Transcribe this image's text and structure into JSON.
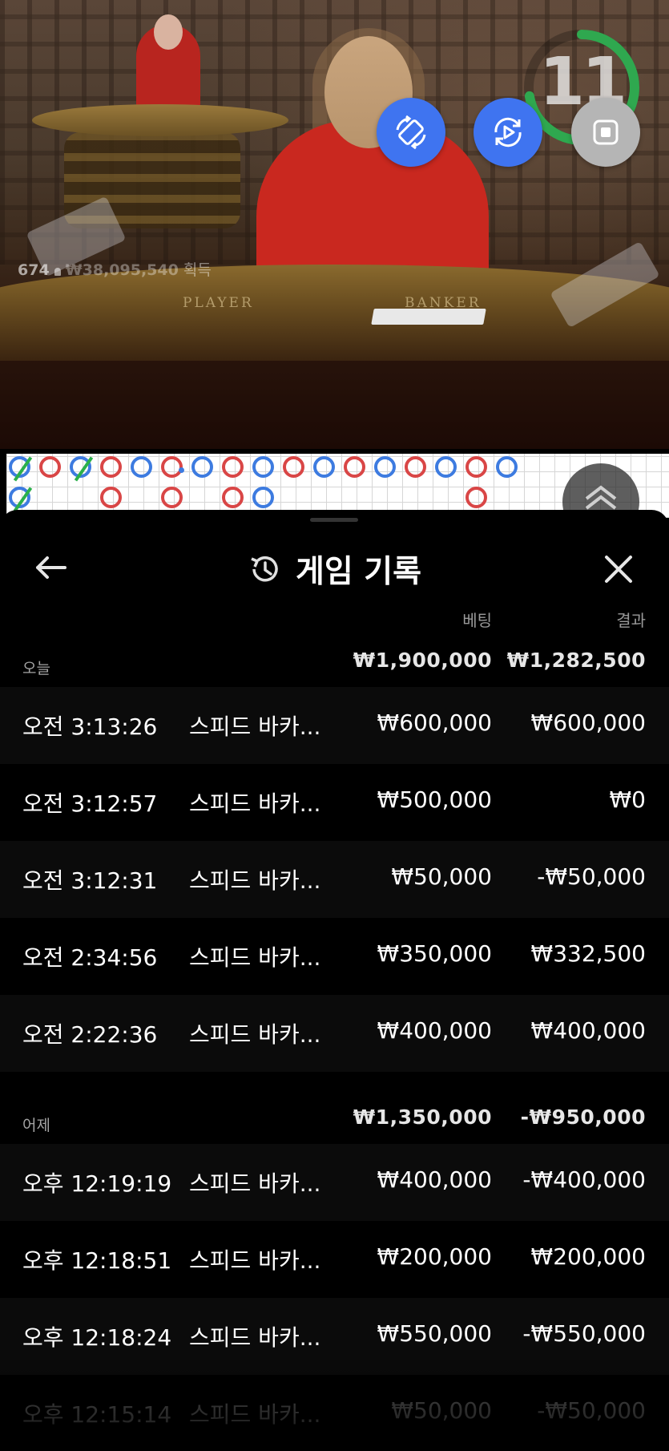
{
  "video": {
    "timer_value": "11",
    "table_labels": [
      "PLAYER",
      "BANKER"
    ],
    "player_count": "674",
    "total_amount": "₩38,095,540",
    "earn_label": "획득"
  },
  "roadmap": {
    "top_row": [
      "P-tie",
      "B",
      "P-tie",
      "B",
      "P",
      "B-dot",
      "P",
      "B",
      "P",
      "B",
      "P",
      "B",
      "P",
      "B",
      "P",
      "B",
      "P"
    ],
    "second_row": [
      "P-tie",
      "",
      "",
      "B",
      "",
      "B",
      "",
      "B",
      "P",
      "",
      "",
      "",
      "",
      "",
      "",
      "B",
      ""
    ]
  },
  "panel": {
    "title": "게임 기록",
    "col_bet": "베팅",
    "col_result": "결과",
    "sections": [
      {
        "label": "오늘",
        "total_bet": "₩1,900,000",
        "total_result": "₩1,282,500",
        "rows": [
          {
            "time": "오전 3:13:26",
            "game": "스피드 바카...",
            "bet": "₩600,000",
            "result": "₩600,000"
          },
          {
            "time": "오전 3:12:57",
            "game": "스피드 바카...",
            "bet": "₩500,000",
            "result": "₩0"
          },
          {
            "time": "오전 3:12:31",
            "game": "스피드 바카...",
            "bet": "₩50,000",
            "result": "-₩50,000"
          },
          {
            "time": "오전 2:34:56",
            "game": "스피드 바카...",
            "bet": "₩350,000",
            "result": "₩332,500"
          },
          {
            "time": "오전 2:22:36",
            "game": "스피드 바카...",
            "bet": "₩400,000",
            "result": "₩400,000"
          }
        ]
      },
      {
        "label": "어제",
        "total_bet": "₩1,350,000",
        "total_result": "-₩950,000",
        "rows": [
          {
            "time": "오후 12:19:19",
            "game": "스피드 바카...",
            "bet": "₩400,000",
            "result": "-₩400,000"
          },
          {
            "time": "오후 12:18:51",
            "game": "스피드 바카...",
            "bet": "₩200,000",
            "result": "₩200,000"
          },
          {
            "time": "오후 12:18:24",
            "game": "스피드 바카...",
            "bet": "₩550,000",
            "result": "-₩550,000"
          },
          {
            "time": "오후 12:15:14",
            "game": "스피드 바카...",
            "bet": "₩50,000",
            "result": "-₩50,000"
          }
        ]
      }
    ]
  },
  "icons": {
    "back": "arrow-left-icon",
    "history": "history-icon",
    "close": "close-icon",
    "rotate": "rotate-icon",
    "video_rotate": "video-rotate-icon",
    "stop": "stop-icon",
    "chevron_up": "chevron-up-icon"
  },
  "colors": {
    "player_blue": "#3d7be0",
    "banker_red": "#d94646",
    "tie_green": "#2bb04a",
    "timer_green": "#2fa84f",
    "fab_blue": "#3f74f0",
    "fab_grey": "#b5b5b5"
  }
}
